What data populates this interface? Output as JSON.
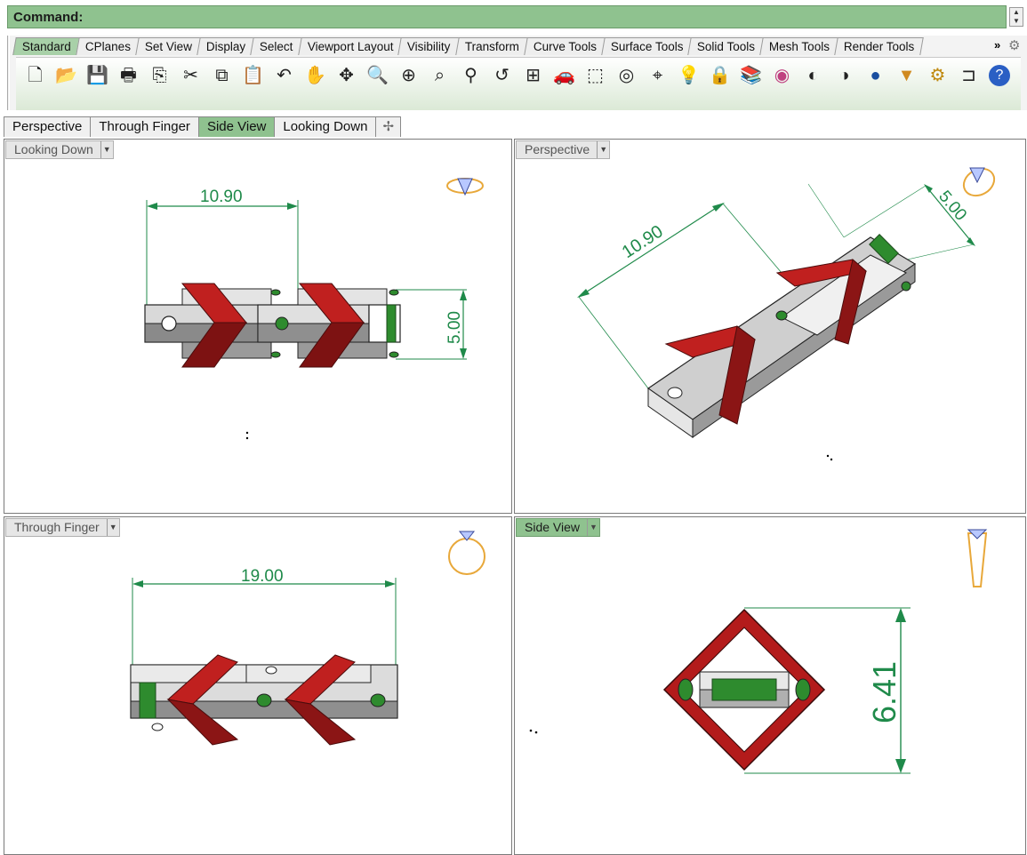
{
  "command_bar": {
    "label": "Command:"
  },
  "toolbar_tabs": [
    "Standard",
    "CPlanes",
    "Set View",
    "Display",
    "Select",
    "Viewport Layout",
    "Visibility",
    "Transform",
    "Curve Tools",
    "Surface Tools",
    "Solid Tools",
    "Mesh Tools",
    "Render Tools"
  ],
  "toolbar_active_tab": "Standard",
  "toolbar_overflow": "»",
  "toolbar_icons": [
    "new-file-icon",
    "open-folder-icon",
    "save-icon",
    "print-icon",
    "import-icon",
    "cut-icon",
    "copy-icon",
    "paste-icon",
    "undo-icon",
    "pan-hand-icon",
    "rotate-view-icon",
    "zoom-dynamic-icon",
    "zoom-window-icon",
    "zoom-extents-icon",
    "zoom-selected-icon",
    "undo-view-icon",
    "four-viewports-icon",
    "car-icon",
    "cplane-icon",
    "circle-point-icon",
    "osnap-icon",
    "light-bulb-icon",
    "lock-icon",
    "layer-icon",
    "color-wheel-icon",
    "shade-icon",
    "rendered-icon",
    "render-sphere-icon",
    "cone-icon",
    "gear-options-icon",
    "dimension-icon",
    "help-icon"
  ],
  "viewport_tabs": [
    {
      "label": "Perspective",
      "active": false
    },
    {
      "label": "Through Finger",
      "active": false
    },
    {
      "label": "Side View",
      "active": true
    },
    {
      "label": "Looking Down",
      "active": false
    }
  ],
  "viewports": {
    "looking_down": {
      "title": "Looking Down",
      "dims": [
        "10.90",
        "5.00"
      ]
    },
    "perspective": {
      "title": "Perspective",
      "dims": [
        "10.90",
        "5.00"
      ]
    },
    "through_finger": {
      "title": "Through Finger",
      "dims": [
        "19.00"
      ]
    },
    "side_view": {
      "title": "Side View",
      "dims": [
        "6.41"
      ]
    }
  },
  "colors": {
    "active_green": "#8fc28f",
    "dimension_green": "#1f8a4a",
    "model_red": "#b31b1b",
    "pin_green": "#2e8b2e"
  }
}
